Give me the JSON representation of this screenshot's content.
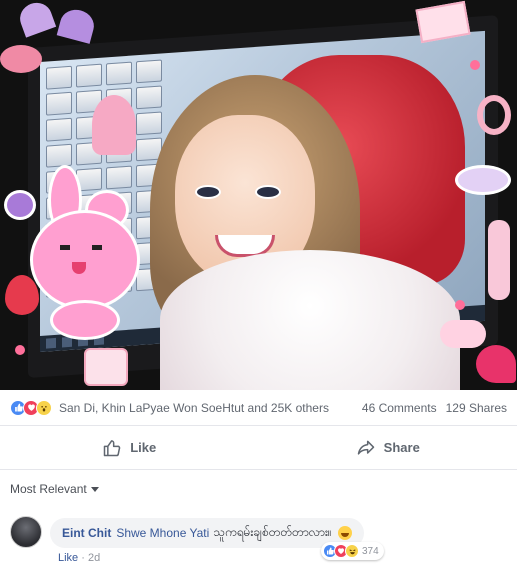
{
  "post": {
    "reactions_summary": {
      "icons": [
        "like-icon",
        "love-icon",
        "wow-icon"
      ],
      "names": "San Di, Khin LaPyae Won SoeHtut and 25K others",
      "comments": "46 Comments",
      "shares": "129 Shares"
    },
    "actions": {
      "like_label": "Like",
      "share_label": "Share"
    }
  },
  "comments_section": {
    "sort_label": "Most Relevant",
    "comments": [
      {
        "author": "Eint Chit",
        "tagged": "Shwe Mhone Yati",
        "text": "သူကရမ်းချစ်တတ်တာလား။",
        "emoji": "grinning-face-icon",
        "reaction_icons": [
          "like-icon",
          "love-icon",
          "haha-icon"
        ],
        "reaction_count": "374",
        "like_link": "Like",
        "separator": "·",
        "time": "2d"
      }
    ]
  },
  "colors": {
    "link_blue": "#385898",
    "like_blue": "#4a8af4",
    "love_red": "#f0405b",
    "wow_yellow": "#f7d24a",
    "meta_gray": "#90949c",
    "border": "#e5e6eb"
  }
}
